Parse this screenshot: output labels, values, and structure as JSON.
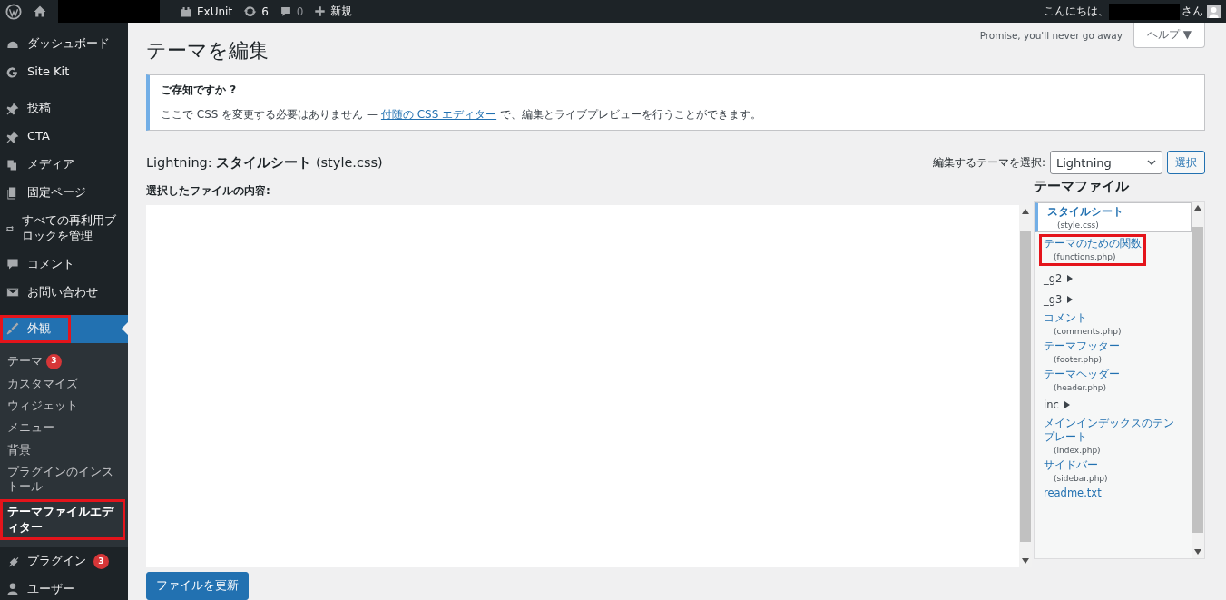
{
  "admin_bar": {
    "site_name": "ExUnit",
    "updates": "6",
    "comments": "0",
    "new": "新規",
    "greeting": "こんにちは、",
    "greeting_suffix": "さん"
  },
  "sidebar": {
    "items": [
      {
        "label": "ダッシュボード",
        "selected": false,
        "highlighted": false
      },
      {
        "label": "Site Kit",
        "selected": false,
        "highlighted": false
      },
      {
        "label": "投稿",
        "selected": false,
        "highlighted": false
      },
      {
        "label": "CTA",
        "selected": false,
        "highlighted": false
      },
      {
        "label": "メディア",
        "selected": false,
        "highlighted": false
      },
      {
        "label": "固定ページ",
        "selected": false,
        "highlighted": false
      },
      {
        "label": "すべての再利用ブロックを管理",
        "selected": false,
        "highlighted": false
      },
      {
        "label": "コメント",
        "selected": false,
        "highlighted": false
      },
      {
        "label": "お問い合わせ",
        "selected": false,
        "highlighted": false
      },
      {
        "label": "外観",
        "selected": true,
        "highlighted": true,
        "children": [
          {
            "label": "テーマ",
            "badge": "3",
            "selected": false,
            "highlighted": false
          },
          {
            "label": "カスタマイズ",
            "selected": false,
            "highlighted": false
          },
          {
            "label": "ウィジェット",
            "selected": false,
            "highlighted": false
          },
          {
            "label": "メニュー",
            "selected": false,
            "highlighted": false
          },
          {
            "label": "背景",
            "selected": false,
            "highlighted": false
          },
          {
            "label": "プラグインのインストール",
            "selected": false,
            "highlighted": false
          },
          {
            "label": "テーマファイルエディター",
            "selected": true,
            "highlighted": true
          }
        ]
      },
      {
        "label": "プラグイン",
        "badge": "3",
        "selected": false,
        "highlighted": false
      },
      {
        "label": "ユーザー",
        "selected": false,
        "highlighted": false
      }
    ]
  },
  "page": {
    "title": "テーマを編集",
    "screen_meta_note": "Promise, you'll never go away",
    "help_button": "ヘルプ ▼"
  },
  "notice": {
    "title": "ご存知ですか ?",
    "text_before": "ここで CSS を変更する必要はありません — ",
    "link": "付随の CSS エディター",
    "text_after": " で、編集とライブプレビューを行うことができます。"
  },
  "editor": {
    "heading": "Lightning: **スタイルシート** (style.css)",
    "theme_select_label": "編集するテーマを選択:",
    "theme_select_value": "Lightning",
    "select_button": "選択",
    "content_label": "選択したファイルの内容:",
    "update_button": "ファイルを更新"
  },
  "theme_files": {
    "title": "テーマファイル",
    "items": [
      {
        "kind": "file",
        "label": "スタイルシート",
        "filename": "(style.css)",
        "selected": true,
        "highlighted": false
      },
      {
        "kind": "file",
        "label": "テーマのための関数",
        "filename": "(functions.php)",
        "selected": false,
        "highlighted": true
      },
      {
        "kind": "folder",
        "label": "_g2",
        "expanded": false
      },
      {
        "kind": "folder",
        "label": "_g3",
        "expanded": false
      },
      {
        "kind": "file",
        "label": "コメント",
        "filename": "(comments.php)",
        "selected": false,
        "highlighted": false
      },
      {
        "kind": "file",
        "label": "テーマフッター",
        "filename": "(footer.php)",
        "selected": false,
        "highlighted": false
      },
      {
        "kind": "file",
        "label": "テーマヘッダー",
        "filename": "(header.php)",
        "selected": false,
        "highlighted": false
      },
      {
        "kind": "folder",
        "label": "inc",
        "expanded": false
      },
      {
        "kind": "file",
        "label": "メインインデックスのテンプレート",
        "filename": "(index.php)",
        "selected": false,
        "highlighted": false
      },
      {
        "kind": "file",
        "label": "サイドバー",
        "filename": "(sidebar.php)",
        "selected": false,
        "highlighted": false
      },
      {
        "kind": "file",
        "label": "readme.txt",
        "selected": false,
        "highlighted": false
      }
    ]
  }
}
